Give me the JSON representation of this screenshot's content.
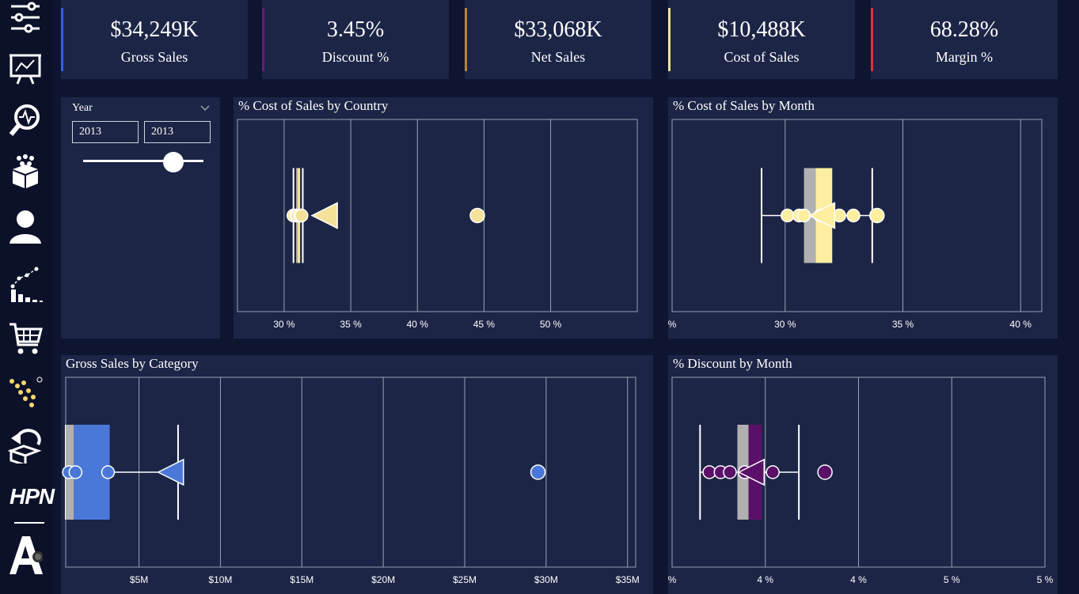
{
  "sidebar": {
    "items": [
      {
        "icon": "sliders-icon"
      },
      {
        "icon": "presentation-chart-icon"
      },
      {
        "icon": "magnifier-pulse-icon"
      },
      {
        "icon": "product-box-icon"
      },
      {
        "icon": "user-icon"
      },
      {
        "icon": "trend-chart-icon"
      },
      {
        "icon": "shopping-cart-icon"
      },
      {
        "icon": "scatter-dots-icon"
      },
      {
        "icon": "return-box-icon"
      }
    ],
    "brand_text": "HPN"
  },
  "kpis": [
    {
      "value": "$34,249K",
      "label": "Gross Sales",
      "color": "#3a5fd9"
    },
    {
      "value": "3.45%",
      "label": "Discount %",
      "color": "#6a1a7a"
    },
    {
      "value": "$33,068K",
      "label": "Net Sales",
      "color": "#b8862a"
    },
    {
      "value": "$10,488K",
      "label": "Cost of Sales",
      "color": "#f5e29a"
    },
    {
      "value": "68.28%",
      "label": "Margin %",
      "color": "#e0313a"
    }
  ],
  "slicer": {
    "title": "Year",
    "from": "2013",
    "to": "2013",
    "slider_position": 0.75
  },
  "chart_data": [
    {
      "type": "boxplot",
      "title": "% Cost of Sales by Country",
      "xlim": [
        26.5,
        56.5
      ],
      "ticks": [
        30,
        35,
        40,
        45,
        50
      ],
      "tick_labels": [
        "30 %",
        "35 %",
        "40 %",
        "45 %",
        "50 %"
      ],
      "color": "#f5e29a",
      "box": {
        "whisker_low": 30.7,
        "q1": 30.9,
        "median": 31.0,
        "q3": 31.2,
        "whisker_high": 31.4
      },
      "points": [
        30.7,
        30.9,
        31.0,
        31.2,
        31.3
      ],
      "outliers": [
        44.5
      ],
      "mean": 33.1
    },
    {
      "type": "boxplot",
      "title": "% Cost of Sales by Month",
      "xlim": [
        25.2,
        40.9
      ],
      "ticks": [
        25.2,
        30,
        35,
        40
      ],
      "tick_labels": [
        "%",
        "30 %",
        "35 %",
        "40 %"
      ],
      "color": "#fdeea0",
      "box": {
        "whisker_low": 29.0,
        "q1": 30.8,
        "median": 31.3,
        "q3": 32.0,
        "whisker_high": 33.7
      },
      "points": [
        30.1,
        30.6,
        30.8,
        31.5,
        32.3,
        32.9
      ],
      "outliers": [
        33.9
      ],
      "mean": 31.6
    },
    {
      "type": "boxplot",
      "title": "Gross Sales by Category",
      "xlim": [
        0.5,
        35.5
      ],
      "ticks": [
        5,
        10,
        15,
        20,
        25,
        30,
        35
      ],
      "tick_labels": [
        "$5M",
        "$10M",
        "$15M",
        "$20M",
        "$25M",
        "$30M",
        "$35M"
      ],
      "color": "#4a78d8",
      "box": {
        "whisker_low": 0.5,
        "q1": 0.5,
        "median": 1.0,
        "q3": 3.2,
        "whisker_high": 7.4
      },
      "points": [
        0.7,
        1.1,
        3.1
      ],
      "outliers": [
        29.5
      ],
      "mean": 7.0
    },
    {
      "type": "boxplot",
      "title": "% Discount by Month",
      "xlim": [
        3.0,
        5.0
      ],
      "ticks": [
        3.0,
        3.5,
        4.0,
        4.5,
        5.0
      ],
      "tick_labels": [
        "%",
        "4 %",
        "4 %",
        "5 %",
        "5 %"
      ],
      "color": "#5a1068",
      "box": {
        "whisker_low": 3.15,
        "q1": 3.35,
        "median": 3.41,
        "q3": 3.48,
        "whisker_high": 3.68
      },
      "points": [
        3.2,
        3.26,
        3.31,
        3.39,
        3.54
      ],
      "outliers": [
        3.82
      ],
      "mean": 3.43
    }
  ]
}
